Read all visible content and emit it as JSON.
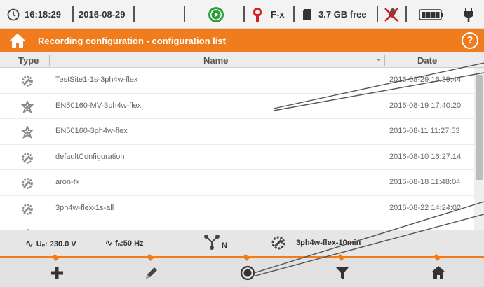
{
  "statusbar": {
    "time": "16:18:29",
    "date": "2016-08-29",
    "clamp": "F-x",
    "storage": "3.7 GB free"
  },
  "titlebar": {
    "title": "Recording configuration - configuration list",
    "help_label": "?"
  },
  "table": {
    "headers": {
      "type": "Type",
      "name": "Name",
      "date": "Date"
    },
    "rows": [
      {
        "icon": "wrench-gear-icon",
        "name": "TestSite1-1s-3ph4w-flex",
        "date": "2016-08-29 16:39:44"
      },
      {
        "icon": "star-gear-icon",
        "name": "EN50160-MV-3ph4w-flex",
        "date": "2016-08-19 17:40:20"
      },
      {
        "icon": "star-gear-icon",
        "name": "EN50160-3ph4w-flex",
        "date": "2016-08-11 11:27:53"
      },
      {
        "icon": "wrench-gear-icon",
        "name": "defaultConfiguration",
        "date": "2016-08-10 16:27:14"
      },
      {
        "icon": "wrench-gear-icon",
        "name": "aron-fx",
        "date": "2016-08-18 11:48:04"
      },
      {
        "icon": "wrench-gear-icon",
        "name": "3ph4w-flex-1s-all",
        "date": "2016-08-22 14:24:02"
      },
      {
        "icon": "wrench-gear-active-icon",
        "name": "",
        "date": ""
      }
    ]
  },
  "infobar": {
    "voltage": "Uₙ: 230.0 V",
    "frequency": "fₙ:50 Hz",
    "network_symbol": "N",
    "active_config": "3ph4w-flex-10min"
  },
  "toolbar": {
    "buttons": [
      {
        "icon": "plus-icon"
      },
      {
        "icon": "pencil-icon"
      },
      {
        "icon": "record-icon"
      },
      {
        "icon": "filter-icon"
      },
      {
        "icon": "home-icon"
      }
    ]
  },
  "colors": {
    "accent": "#f07c1d",
    "statusbar_bg": "#f3f3f3",
    "toolbar_bg": "#e1e1e1",
    "row_icon": "#8a8a8a",
    "active_green": "#3cb043"
  }
}
